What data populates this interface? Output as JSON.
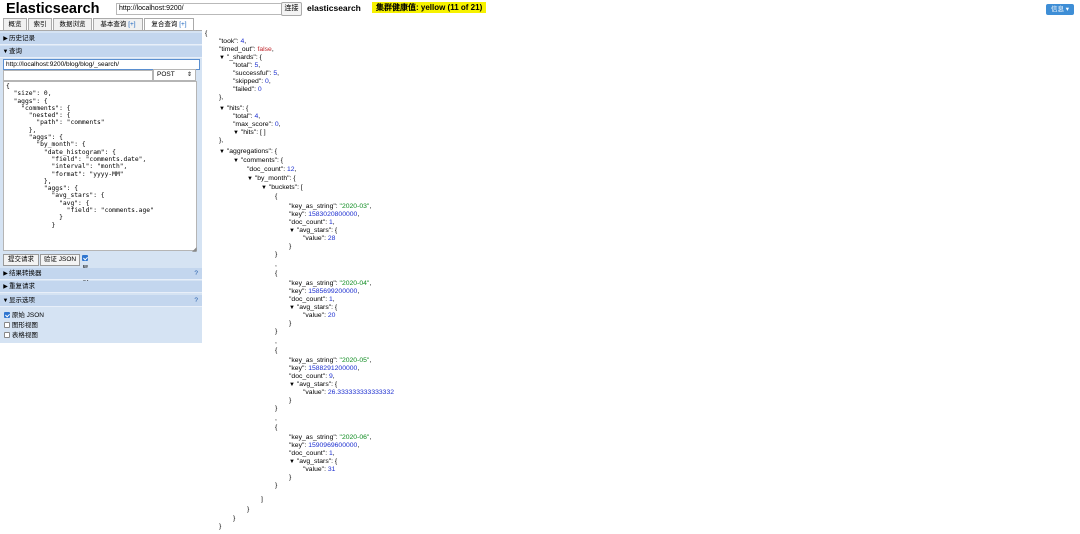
{
  "header": {
    "logo": "Elasticsearch",
    "url": "http://localhost:9200/",
    "connect_label": "连接",
    "cluster_name": "elasticsearch",
    "health": "集群健康值: yellow (11 of 21)",
    "info_label": "信息 ▾"
  },
  "tabs": [
    {
      "label": "概览"
    },
    {
      "label": "索引"
    },
    {
      "label": "数据浏览"
    },
    {
      "label": "基本查询",
      "plus": "[+]"
    },
    {
      "label": "复合查询",
      "plus": "[+]"
    }
  ],
  "left": {
    "history_label": "历史记录",
    "query_label": "查询",
    "query_url": "http://localhost:9200/blog/blog/_search/",
    "method": "POST",
    "method_arrow": "⇕",
    "body_lines": [
      "{",
      "  \"size\": 0,",
      "  \"aggs\": {",
      "    \"comments\": {",
      "      \"nested\": {",
      "        \"path\": \"comments\"",
      "      },",
      "      \"aggs\": {",
      "        \"by_month\": {",
      "          \"date_histogram\": {",
      "            \"field\": \"comments.date\",",
      "            \"interval\": \"month\",",
      "            \"format\": \"yyyy-MM\"",
      "          },",
      "          \"aggs\": {",
      "            \"avg_stars\": {",
      "              \"avg\": {",
      "                \"field\": \"comments.age\"",
      "              }",
      "            }"
    ],
    "submit_label": "提交请求",
    "validate_label": "验证 JSON",
    "pretty_label": "易读",
    "transformer_label": "结果转换器",
    "repeat_label": "重复请求",
    "display_label": "显示选项",
    "help": "?",
    "display_options": [
      "原始 JSON",
      "图形视图",
      "表格视图"
    ]
  },
  "result": {
    "took": 4,
    "timed_out": "false",
    "shards_total": 5,
    "shards_successful": 5,
    "shards_skipped": 0,
    "shards_failed": 0,
    "hits_total": 4,
    "max_score": 0,
    "hits_hits": "[ ]",
    "doc_count": 12,
    "buckets": [
      {
        "key_as_string": "\"2020-03\"",
        "key": 1583020800000,
        "doc_count": 1,
        "value": 28
      },
      {
        "key_as_string": "\"2020-04\"",
        "key": 1585699200000,
        "doc_count": 1,
        "value": 20
      },
      {
        "key_as_string": "\"2020-05\"",
        "key": 1588291200000,
        "doc_count": 9,
        "value": 26.333333333333332
      },
      {
        "key_as_string": "\"2020-06\"",
        "key": 1590969600000,
        "doc_count": 1,
        "value": 31
      }
    ]
  }
}
